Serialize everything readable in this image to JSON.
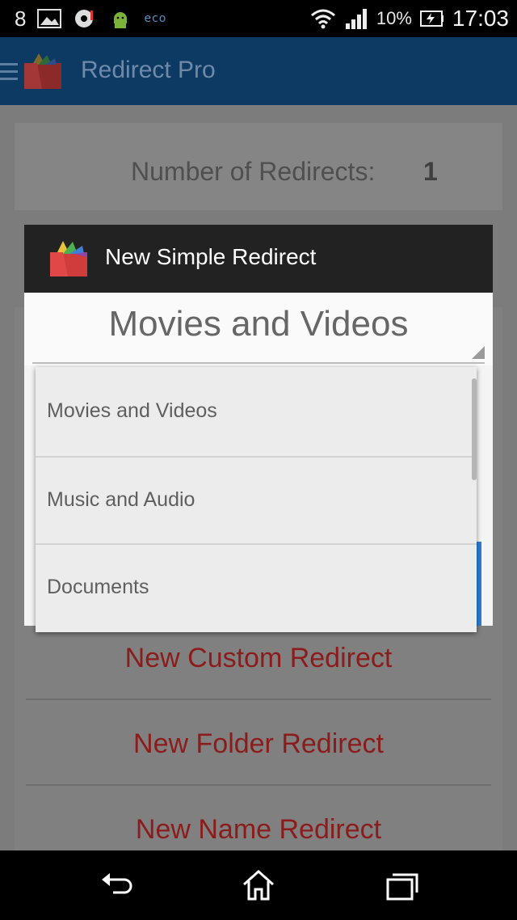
{
  "status_bar": {
    "notif_count": "8",
    "eco_label": "eco",
    "battery_percent": "10%",
    "time": "17:03"
  },
  "action_bar": {
    "title": "Redirect Pro"
  },
  "content": {
    "count_label": "Number of Redirects:",
    "count_value": "1",
    "buttons": [
      "New Custom Redirect",
      "New Folder Redirect",
      "New Name Redirect"
    ]
  },
  "dialog": {
    "title": "New Simple Redirect",
    "selected_value": "Movies and Videos"
  },
  "dropdown": {
    "options": [
      "Movies and Videos",
      "Music and Audio",
      "Documents"
    ]
  },
  "colors": {
    "action_bar": "#0c3a63",
    "redirect_button_text": "#8b1c1c",
    "accent_blue": "#2a7ed6"
  }
}
